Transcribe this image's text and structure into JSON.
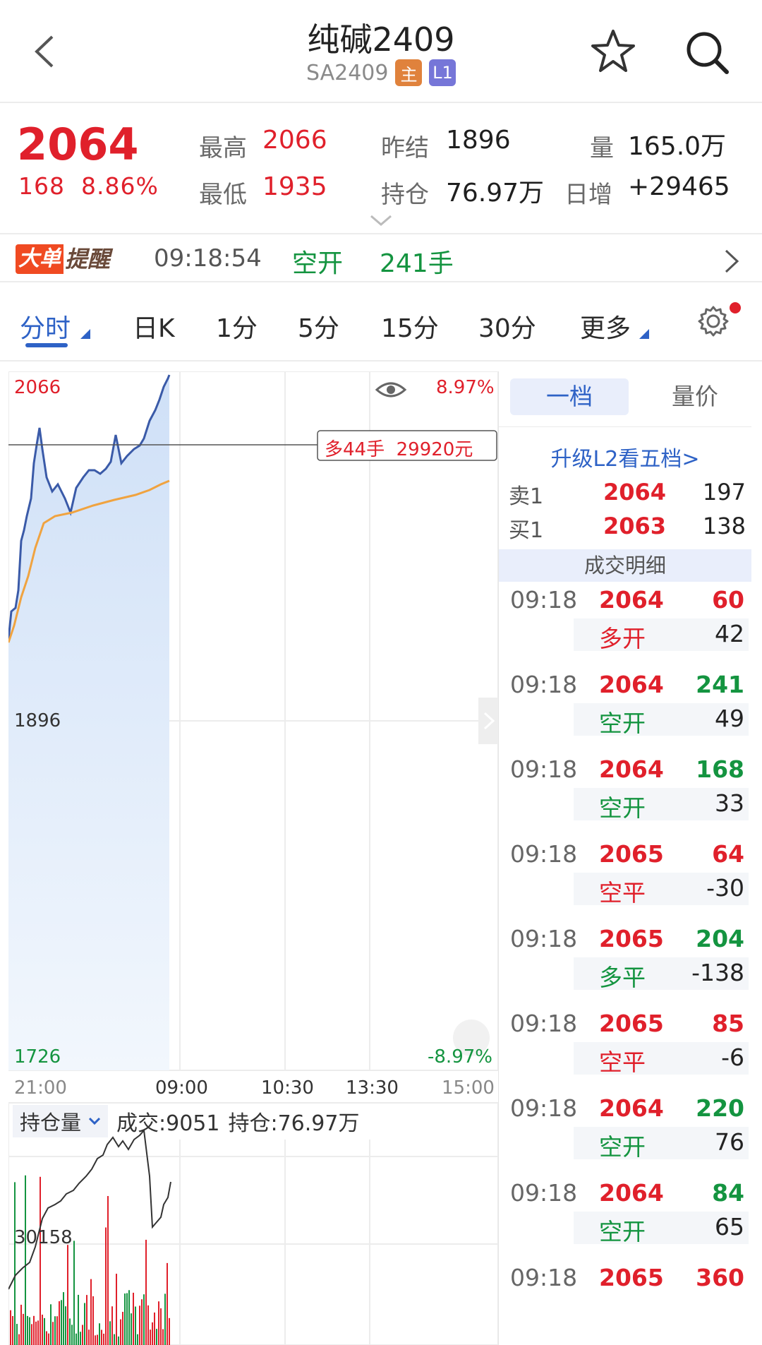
{
  "header": {
    "title": "纯碱2409",
    "code": "SA2409",
    "tag_main": "主",
    "tag_level": "L1"
  },
  "quote": {
    "price": "2064",
    "change": "168",
    "change_pct": "8.86%",
    "high_label": "最高",
    "high": "2066",
    "low_label": "最低",
    "low": "1935",
    "prev_settle_label": "昨结",
    "prev_settle": "1896",
    "oi_label": "持仓",
    "oi": "76.97万",
    "vol_label": "量",
    "vol": "165.0万",
    "daily_inc_label": "日增",
    "daily_inc": "+29465"
  },
  "alert": {
    "logo_a": "大单",
    "logo_b": "提醒",
    "time": "09:18:54",
    "type": "空开",
    "lots": "241手"
  },
  "tabs": [
    {
      "label": "分时",
      "active": true
    },
    {
      "label": "日K"
    },
    {
      "label": "1分"
    },
    {
      "label": "5分"
    },
    {
      "label": "15分"
    },
    {
      "label": "30分"
    },
    {
      "label": "更多"
    }
  ],
  "chart": {
    "top_price": "2066",
    "top_pct": "8.97%",
    "mid_price": "1896",
    "bottom_price": "1726",
    "bottom_pct": "-8.97%",
    "cursor_label": "多44手  29920元",
    "time_labels": [
      "21:00",
      "09:00",
      "10:30",
      "13:30",
      "15:00"
    ],
    "oi_selector": "持仓量",
    "deal": "成交:9051",
    "oi": "持仓:76.97万",
    "oi_axis": "30158",
    "colors": {
      "price_line": "#3a5aa8",
      "avg_line": "#f0a340",
      "up": "#e0202b",
      "down": "#149440"
    }
  },
  "chart_data": {
    "type": "line",
    "x": [
      "21:00",
      "09:00",
      "10:30",
      "13:30",
      "15:00"
    ],
    "ylim": [
      1726,
      2066
    ],
    "series": []
  },
  "book": {
    "tab_level1": "一档",
    "tab_vol_price": "量价",
    "upgrade": "升级L2看五档>",
    "sell1": {
      "label": "卖1",
      "price": "2064",
      "vol": "197"
    },
    "buy1": {
      "label": "买1",
      "price": "2063",
      "vol": "138"
    },
    "detail_title": "成交明细",
    "trades": [
      {
        "time": "09:18",
        "price": "2064",
        "vol": "60",
        "vol_color": "red",
        "kind": "多开",
        "kind_color": "red",
        "delta": "42"
      },
      {
        "time": "09:18",
        "price": "2064",
        "vol": "241",
        "vol_color": "green",
        "kind": "空开",
        "kind_color": "green",
        "delta": "49"
      },
      {
        "time": "09:18",
        "price": "2064",
        "vol": "168",
        "vol_color": "green",
        "kind": "空开",
        "kind_color": "green",
        "delta": "33"
      },
      {
        "time": "09:18",
        "price": "2065",
        "vol": "64",
        "vol_color": "red",
        "kind": "空平",
        "kind_color": "red",
        "delta": "-30"
      },
      {
        "time": "09:18",
        "price": "2065",
        "vol": "204",
        "vol_color": "green",
        "kind": "多平",
        "kind_color": "green",
        "delta": "-138"
      },
      {
        "time": "09:18",
        "price": "2065",
        "vol": "85",
        "vol_color": "red",
        "kind": "空平",
        "kind_color": "red",
        "delta": "-6"
      },
      {
        "time": "09:18",
        "price": "2064",
        "vol": "220",
        "vol_color": "green",
        "kind": "空开",
        "kind_color": "green",
        "delta": "76"
      },
      {
        "time": "09:18",
        "price": "2064",
        "vol": "84",
        "vol_color": "green",
        "kind": "空开",
        "kind_color": "green",
        "delta": "65"
      },
      {
        "time": "09:18",
        "price": "2065",
        "vol": "360",
        "vol_color": "red"
      }
    ]
  }
}
